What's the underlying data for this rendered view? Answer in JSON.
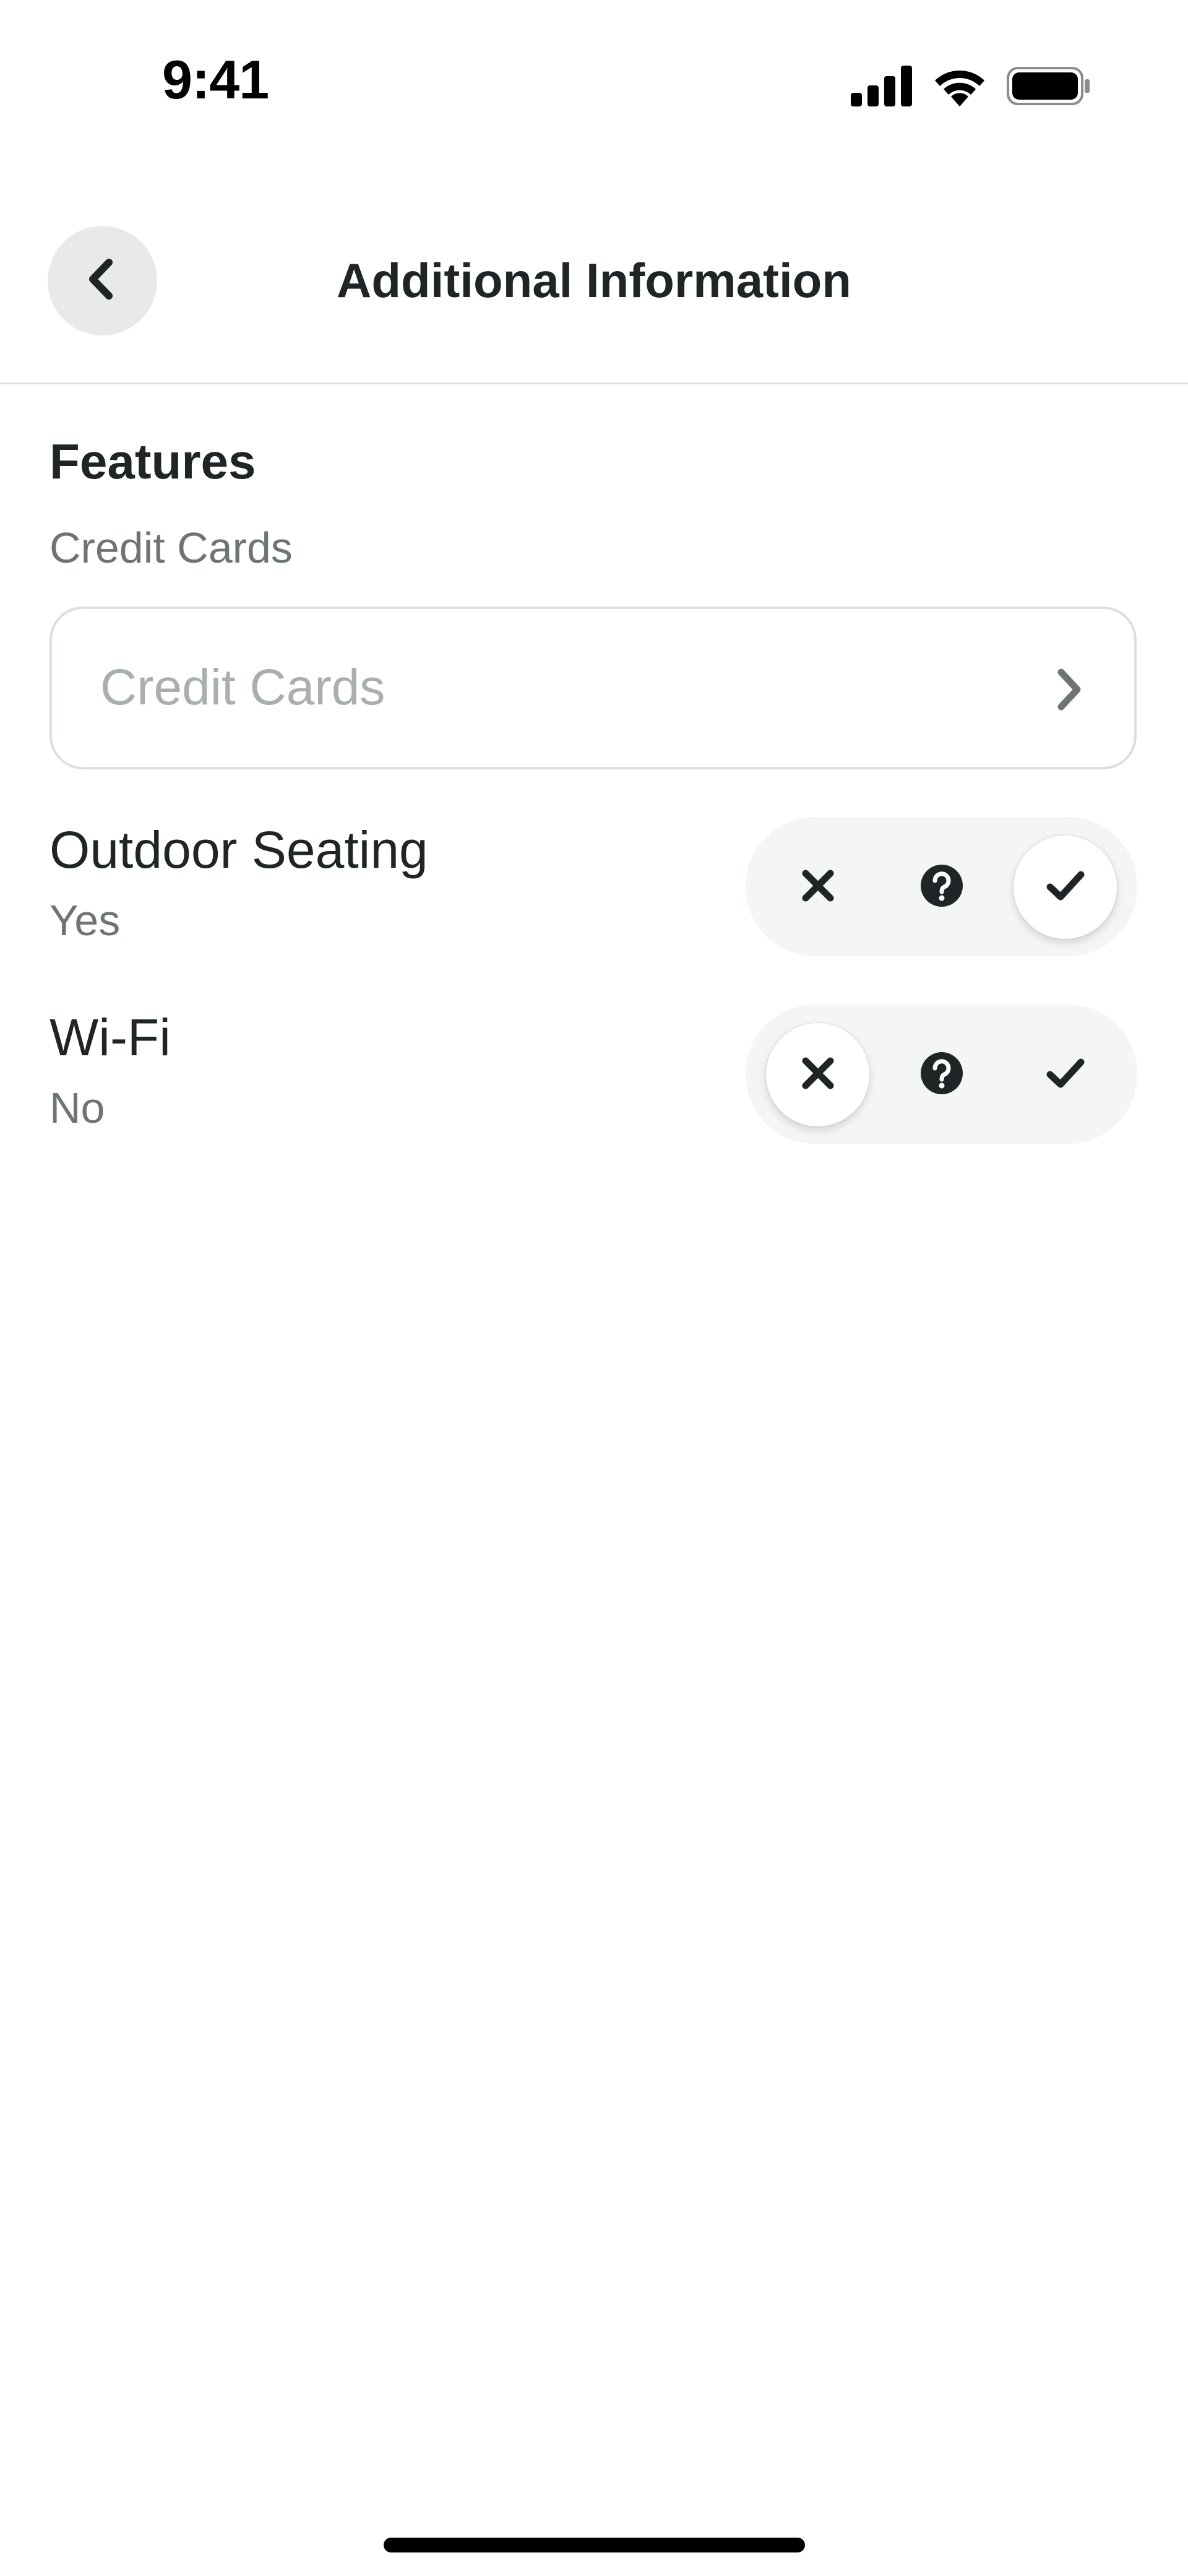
{
  "status_bar": {
    "time": "9:41",
    "icons": [
      "signal-icon",
      "wifi-icon",
      "battery-icon"
    ]
  },
  "header": {
    "title": "Additional Information",
    "back_icon": "chevron-left-icon"
  },
  "features": {
    "section_title": "Features",
    "credit_cards": {
      "label": "Credit Cards",
      "placeholder": "Credit Cards",
      "icon": "chevron-right-icon"
    },
    "items": [
      {
        "name": "Outdoor Seating",
        "status": "Yes",
        "selected": "yes"
      },
      {
        "name": "Wi-Fi",
        "status": "No",
        "selected": "no"
      }
    ],
    "toggle_icons": [
      "close-icon",
      "question-icon",
      "check-icon"
    ]
  },
  "colors": {
    "text_primary": "#1f2526",
    "text_secondary": "#6e7476",
    "placeholder": "#a9aeb0",
    "toggle_track": "#f4f5f5",
    "back_button_bg": "#e8e9ea",
    "divider": "#e0e2e3"
  }
}
